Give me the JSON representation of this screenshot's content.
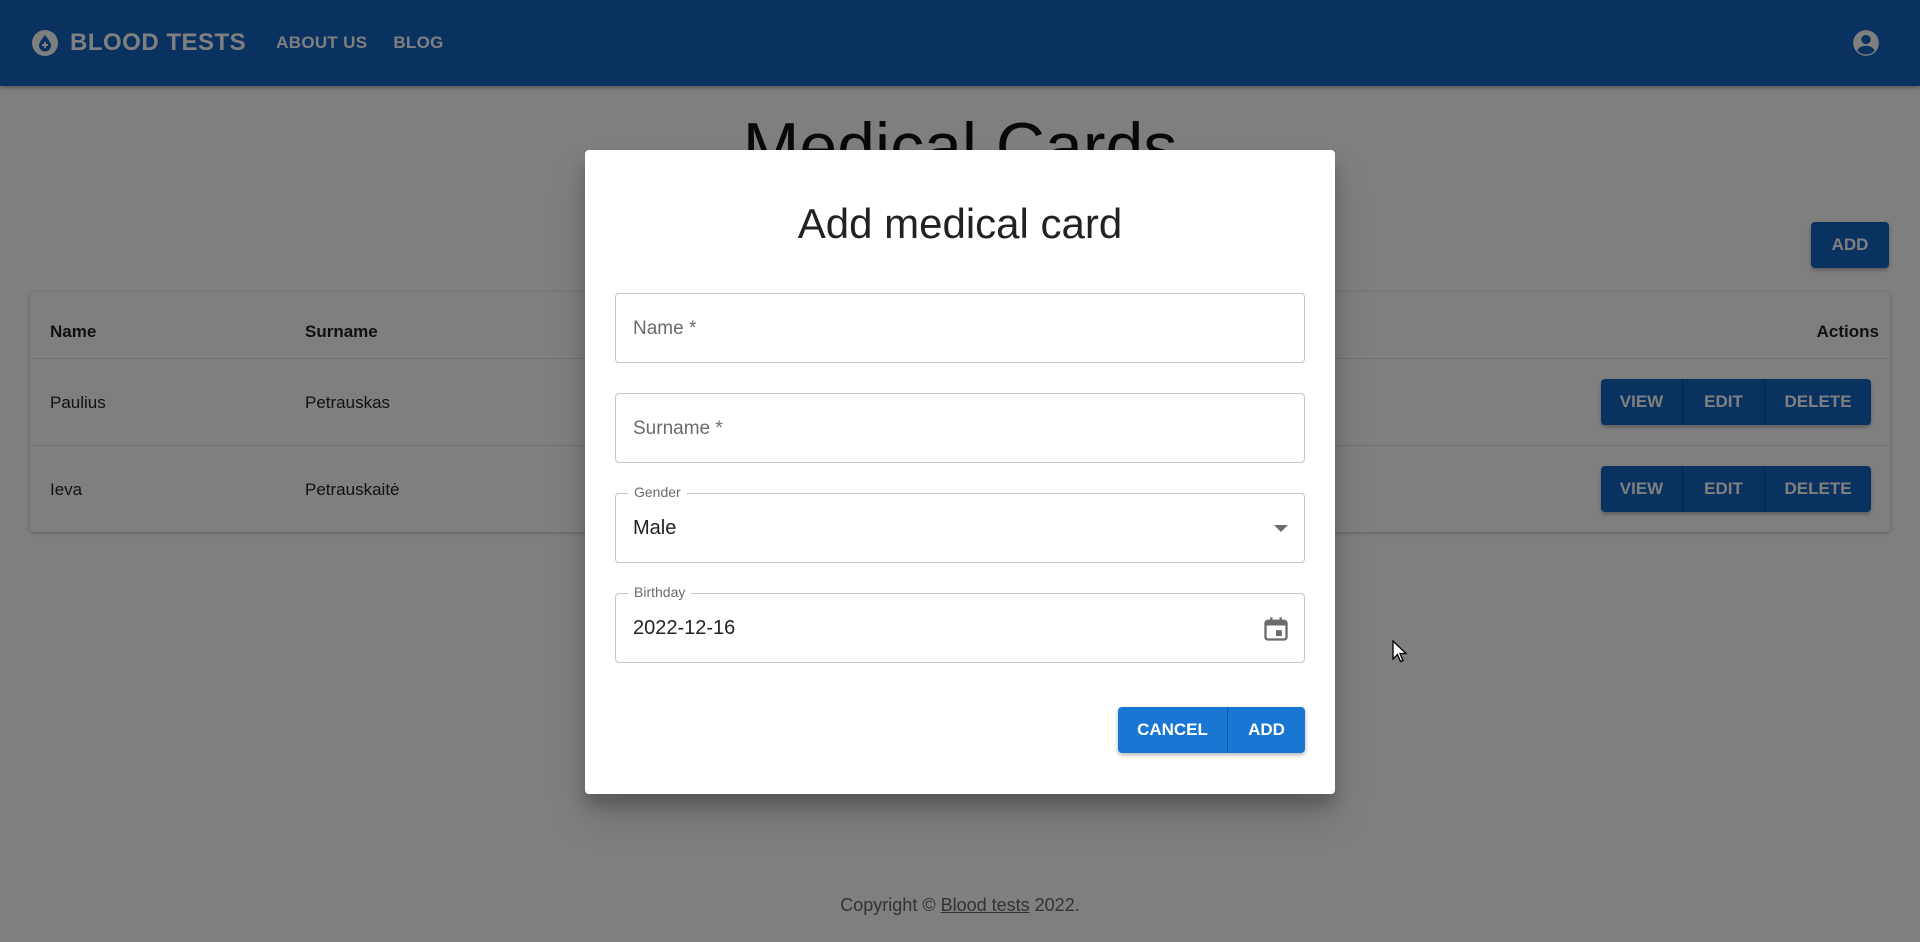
{
  "appbar": {
    "brand": "BLOOD TESTS",
    "brand_icon": "blood-drop-icon",
    "nav": [
      "ABOUT US",
      "BLOG"
    ],
    "account_icon": "account-circle-icon",
    "color": "#1565c0"
  },
  "page": {
    "title": "Medical Cards",
    "add_label": "ADD"
  },
  "table": {
    "headers": {
      "name": "Name",
      "surname": "Surname",
      "actions": "Actions"
    },
    "rows": [
      {
        "name": "Paulius",
        "surname": "Petrauskas"
      },
      {
        "name": "Ieva",
        "surname": "Petrauskaitė"
      }
    ],
    "row_actions": [
      "VIEW",
      "EDIT",
      "DELETE"
    ]
  },
  "footer": {
    "prefix": "Copyright © ",
    "link": "Blood tests",
    "suffix": " 2022."
  },
  "dialog": {
    "title": "Add medical card",
    "name_placeholder": "Name *",
    "surname_placeholder": "Surname *",
    "gender_label": "Gender",
    "gender_value": "Male",
    "birthday_label": "Birthday",
    "birthday_value": "2022-12-16",
    "calendar_icon": "calendar-icon",
    "cancel_label": "CANCEL",
    "add_label": "ADD",
    "button_color": "#1976d2"
  }
}
